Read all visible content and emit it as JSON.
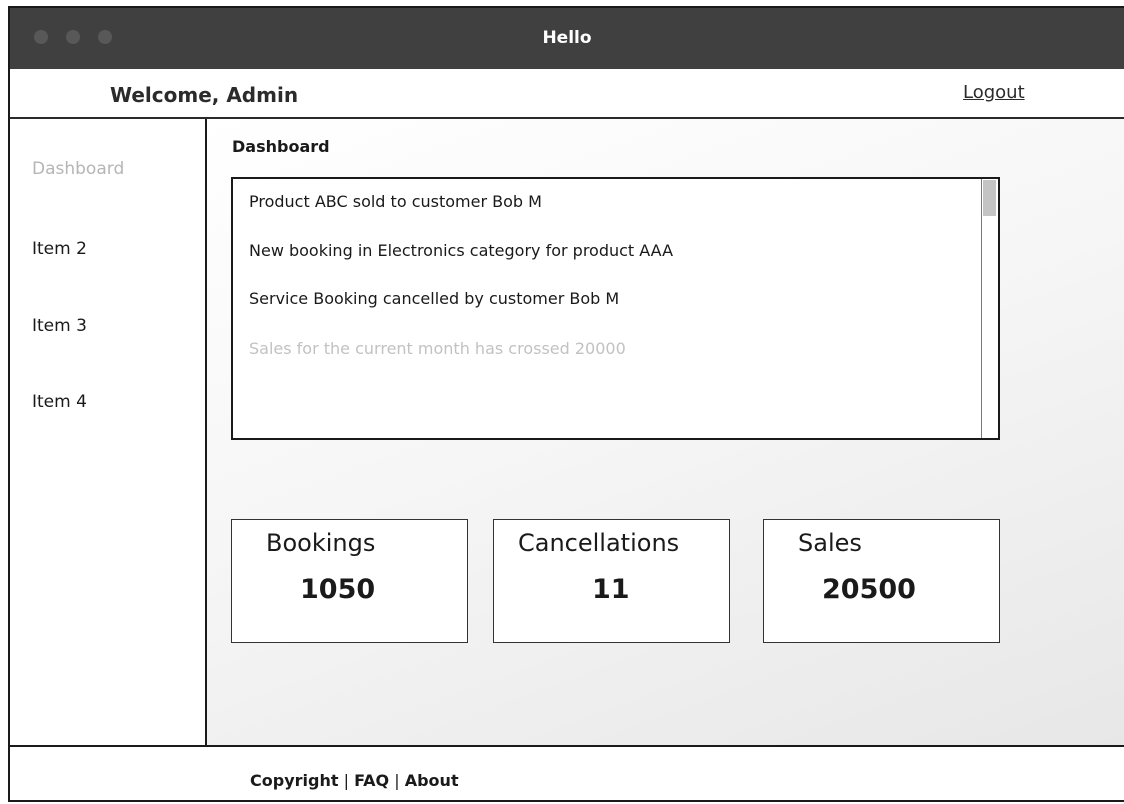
{
  "window": {
    "title": "Hello"
  },
  "header": {
    "welcome": "Welcome, Admin",
    "logout": "Logout"
  },
  "sidebar": {
    "items": [
      {
        "label": "Dashboard",
        "active": true
      },
      {
        "label": "Item 2"
      },
      {
        "label": "Item 3"
      },
      {
        "label": "Item 4"
      }
    ]
  },
  "main": {
    "title": "Dashboard",
    "feed": [
      "Product ABC sold to customer Bob M",
      "New booking in Electronics category for product AAA",
      "Service Booking cancelled by customer Bob M",
      "Sales for the current month has crossed 20000"
    ],
    "cards": [
      {
        "label": "Bookings",
        "value": "1050"
      },
      {
        "label": "Cancellations",
        "value": "11"
      },
      {
        "label": "Sales",
        "value": "20500"
      }
    ]
  },
  "footer": {
    "links": [
      "Copyright",
      "FAQ",
      "About"
    ],
    "separator": "|"
  }
}
